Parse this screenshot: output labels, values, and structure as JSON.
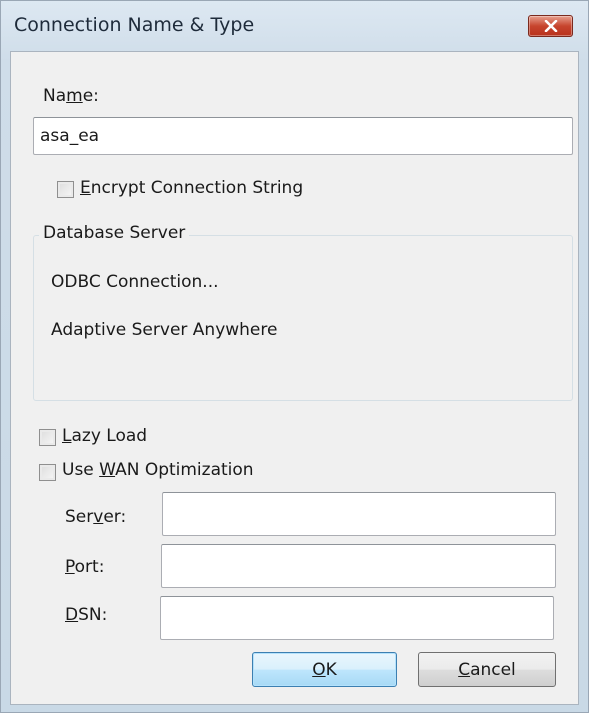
{
  "dialog": {
    "title": "Connection Name & Type"
  },
  "name_field": {
    "label_pre": "Na",
    "label_mnemonic": "m",
    "label_post": "e:",
    "value": "asa_ea"
  },
  "encrypt_checkbox": {
    "label_mnemonic": "E",
    "label_post": "ncrypt Connection String",
    "checked": false
  },
  "database_server": {
    "group_title": "Database Server",
    "connection_type": "ODBC Connection...",
    "server_type": "Adaptive Server Anywhere"
  },
  "lazy_load_checkbox": {
    "label_mnemonic": "L",
    "label_post": "azy Load",
    "checked": false
  },
  "wan_checkbox": {
    "label_pre": "Use ",
    "label_mnemonic": "W",
    "label_post": "AN Optimization",
    "checked": false
  },
  "wan_fields": {
    "server_label_pre": "Ser",
    "server_label_mnemonic": "v",
    "server_label_post": "er:",
    "server_value": "",
    "port_label_mnemonic": "P",
    "port_label_post": "ort:",
    "port_value": "",
    "dsn_label_mnemonic": "D",
    "dsn_label_post": "SN:",
    "dsn_value": ""
  },
  "buttons": {
    "ok_mnemonic": "O",
    "ok_post": "K",
    "cancel_mnemonic": "C",
    "cancel_post": "ancel"
  },
  "icons": {
    "close": "close-icon"
  }
}
